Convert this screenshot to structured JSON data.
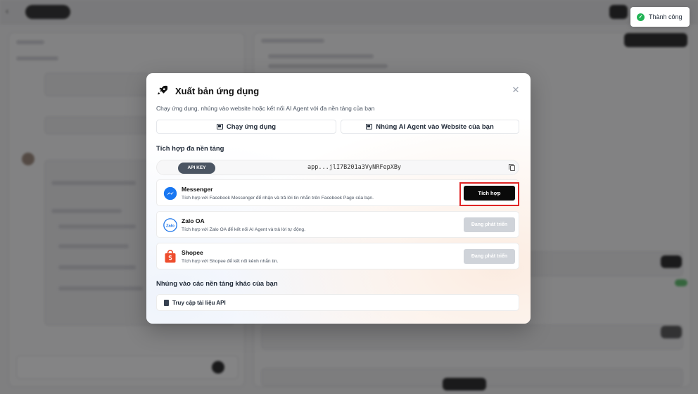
{
  "toast": {
    "message": "Thành công",
    "color": "#22b355"
  },
  "modal": {
    "title": "Xuất bản ứng dụng",
    "subtitle": "Chạy ứng dụng, nhúng vào website hoặc kết nối AI Agent với đa nền tảng của bạn",
    "close_icon": "close-icon",
    "actions": {
      "run_app": "Chạy ứng dụng",
      "embed": "Nhúng AI Agent vào Website của bạn"
    },
    "integration_section_title": "Tích hợp đa nền tảng",
    "api_key": {
      "label": "API KEY",
      "value": "app...jlI7B201a3VyNRFepXBy"
    },
    "integrations": [
      {
        "name": "Messenger",
        "description": "Tích hợp với Facebook Messenger để nhận và trả lời tin nhắn trên Facebook Page của bạn.",
        "button": "Tích hợp",
        "status": "active"
      },
      {
        "name": "Zalo OA",
        "description": "Tích hợp với Zalo OA để kết nối AI Agent và trả lời tự động.",
        "button": "Đang phát triển",
        "status": "disabled",
        "logo_text": "Zalo"
      },
      {
        "name": "Shopee",
        "description": "Tích hợp với Shopee để kết nối kênh nhắn tin.",
        "button": "Đang phát triển",
        "status": "disabled"
      }
    ],
    "other_section_title": "Nhúng vào các nền tảng khác của bạn",
    "docs_link": "Truy cập tài liệu API"
  }
}
